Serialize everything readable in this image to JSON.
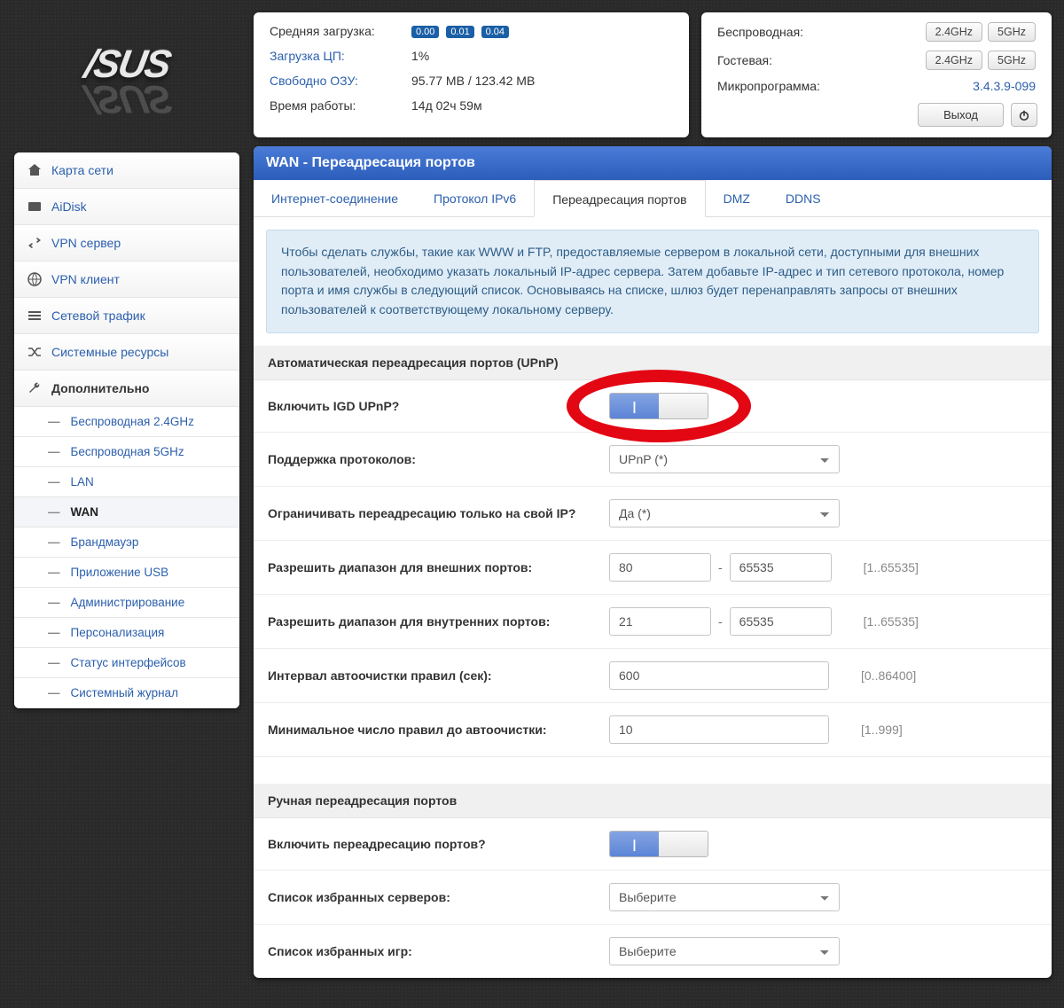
{
  "logo": "/SUS",
  "sidebar": {
    "items": [
      {
        "label": "Карта сети",
        "icon": "home"
      },
      {
        "label": "AiDisk",
        "icon": "disk"
      },
      {
        "label": "VPN сервер",
        "icon": "swap"
      },
      {
        "label": "VPN клиент",
        "icon": "globe"
      },
      {
        "label": "Сетевой трафик",
        "icon": "list"
      },
      {
        "label": "Системные ресурсы",
        "icon": "shuffle"
      },
      {
        "label": "Дополнительно",
        "icon": "wrench",
        "active": true
      }
    ],
    "subitems": [
      {
        "label": "Беспроводная 2.4GHz"
      },
      {
        "label": "Беспроводная 5GHz"
      },
      {
        "label": "LAN"
      },
      {
        "label": "WAN",
        "active": true
      },
      {
        "label": "Брандмауэр"
      },
      {
        "label": "Приложение USB"
      },
      {
        "label": "Администрирование"
      },
      {
        "label": "Персонализация"
      },
      {
        "label": "Статус интерфейсов"
      },
      {
        "label": "Системный журнал"
      }
    ]
  },
  "status_panel": {
    "avg_load_label": "Средняя загрузка:",
    "avg_load_values": [
      "0.00",
      "0.01",
      "0.04"
    ],
    "cpu_label": "Загрузка ЦП:",
    "cpu_value": "1%",
    "ram_label": "Свободно ОЗУ:",
    "ram_value": "95.77 MB / 123.42 MB",
    "uptime_label": "Время работы:",
    "uptime_value": "14д 02ч 59м"
  },
  "wifi_panel": {
    "wireless_label": "Беспроводная:",
    "guest_label": "Гостевая:",
    "firmware_label": "Микропрограмма:",
    "firmware_value": "3.4.3.9-099",
    "btn24": "2.4GHz",
    "btn5": "5GHz",
    "logout_label": "Выход"
  },
  "main": {
    "title": "WAN - Переадресация портов",
    "tabs": [
      {
        "label": "Интернет-соединение"
      },
      {
        "label": "Протокол IPv6"
      },
      {
        "label": "Переадресация портов",
        "active": true
      },
      {
        "label": "DMZ"
      },
      {
        "label": "DDNS"
      }
    ],
    "info": "Чтобы сделать службы, такие как WWW и FTP, предоставляемые сервером в локальной сети, доступными для внешних пользователей, необходимо указать локальный IP-адрес сервера. Затем добавьте IP-адрес и тип сетевого протокола, номер порта и имя службы в следующий список. Основываясь на списке, шлюз будет перенаправлять запросы от внешних пользователей к соответствующему локальному серверу.",
    "section_upnp": "Автоматическая переадресация портов (UPnP)",
    "rows": {
      "enable_igd": "Включить IGD UPnP?",
      "protocols": "Поддержка протоколов:",
      "protocols_value": "UPnP (*)",
      "restrict_ip": "Ограничивать переадресацию только на свой IP?",
      "restrict_ip_value": "Да (*)",
      "ext_range": "Разрешить диапазон для внешних портов:",
      "ext_lo": "80",
      "ext_hi": "65535",
      "ext_hint": "[1..65535]",
      "int_range": "Разрешить диапазон для внутренних портов:",
      "int_lo": "21",
      "int_hi": "65535",
      "int_hint": "[1..65535]",
      "autoclean": "Интервал автоочистки правил (сек):",
      "autoclean_val": "600",
      "autoclean_hint": "[0..86400]",
      "minrules": "Минимальное число правил до автоочистки:",
      "minrules_val": "10",
      "minrules_hint": "[1..999]"
    },
    "section_manual": "Ручная переадресация портов",
    "manual": {
      "enable": "Включить переадресацию портов?",
      "fav_servers": "Список избранных серверов:",
      "fav_games": "Список избранных игр:",
      "select_placeholder": "Выберите"
    }
  }
}
